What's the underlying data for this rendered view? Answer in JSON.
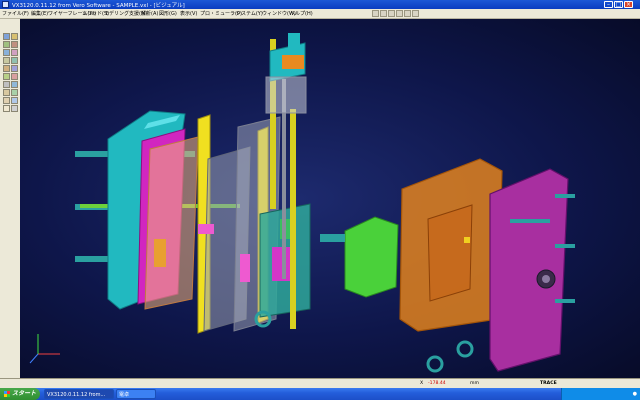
{
  "window": {
    "title": "VX3120.0.11.12 from Vero Software - SAMPLE.vxl - [ビジュアル]"
  },
  "menu": [
    "ファイル(F)",
    "編集(E)",
    "ワイヤーフレーム(W)",
    "ソリッド(S)",
    "モデリング支援(M)",
    "解析(A)",
    "図形(G)",
    "表示(V)",
    "プロ・ミューラ(P)",
    "システム(Y)",
    "ウィンドウ(W)",
    "ヘルプ(H)"
  ],
  "status": {
    "mode": "TRACE",
    "coords_label": "X",
    "coords_value": "-178.44",
    "units": "mm"
  },
  "taskbar": {
    "start": "スタート",
    "tasks": [
      "VX3120.0.11.12 from...",
      "電卓"
    ]
  },
  "colors": {
    "title": "#0a3cc0",
    "viewport": "#0e164a",
    "taskbar": "#245edb"
  }
}
